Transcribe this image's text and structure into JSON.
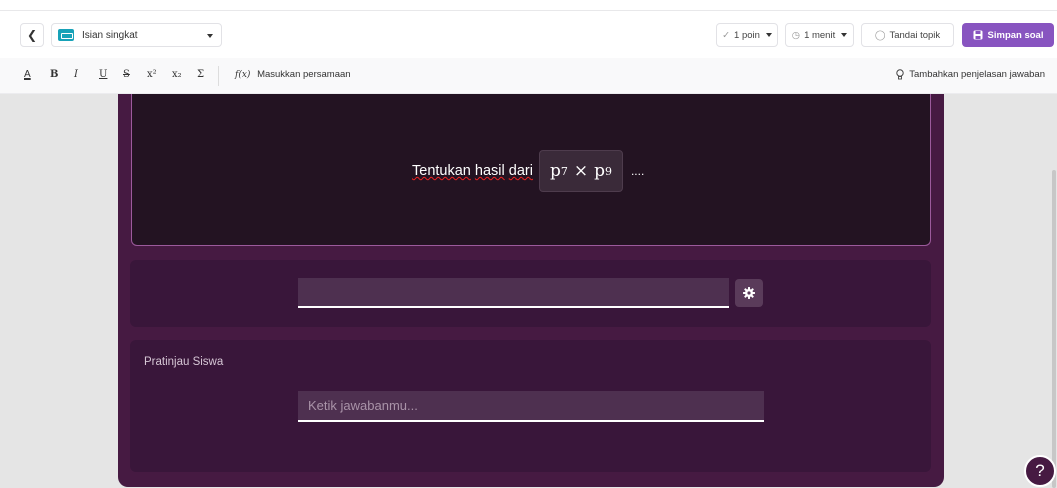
{
  "header": {
    "back_icon": "chevron-left-icon",
    "question_type": "Isian singkat",
    "points": "1 poin",
    "time": "1 menit",
    "tag": "Tandai topik",
    "save": "Simpan soal"
  },
  "formatting": {
    "text_color": "A",
    "bold": "B",
    "italic": "I",
    "underline": "U",
    "strike": "S",
    "superscript": "x²",
    "subscript": "x₂",
    "symbol": "Σ",
    "equation_icon": "f(x)",
    "equation": "Masukkan persamaan",
    "explanation": "Tambahkan penjelasan jawaban"
  },
  "question": {
    "text_part1": "Tentukan",
    "text_part2": "hasil",
    "text_part3": "dari",
    "math_base1": "p",
    "math_exp1": "7",
    "math_op": "×",
    "math_base2": "p",
    "math_exp2": "9",
    "ellipsis": "...."
  },
  "answer": {
    "value": ""
  },
  "preview": {
    "label": "Pratinjau Siswa",
    "placeholder": "Ketik jawabanmu..."
  },
  "help": "?",
  "colors": {
    "accent": "#8854c0",
    "editor_bg": "#461a42",
    "question_bg": "#231322",
    "type_icon": "#17a2b8"
  }
}
